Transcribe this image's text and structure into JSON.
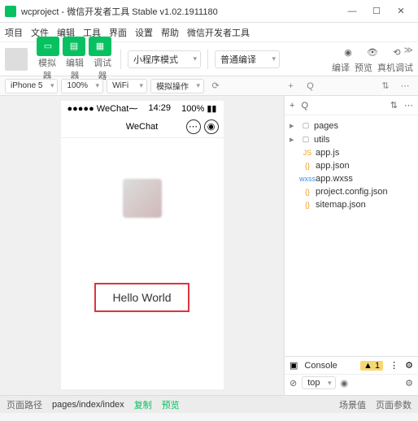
{
  "window": {
    "title": "wcproject - 微信开发者工具 Stable v1.02.1911180"
  },
  "menu": [
    "项目",
    "文件",
    "编辑",
    "工具",
    "界面",
    "设置",
    "帮助",
    "微信开发者工具"
  ],
  "toolbar": {
    "labels": [
      "模拟器",
      "编辑器",
      "调试器"
    ],
    "mode": "小程序模式",
    "compile": "普通编译",
    "right_labels": [
      "编译",
      "预览",
      "真机调试"
    ]
  },
  "subbar": {
    "device": "iPhone 5",
    "zoom": "100%",
    "network": "WiFi",
    "action": "模拟操作"
  },
  "phone": {
    "carrier": "●●●●● WeChat",
    "signal": "⁓",
    "time": "14:29",
    "battery": "100%",
    "title": "WeChat",
    "hello": "Hello World"
  },
  "tree": {
    "folders": [
      "pages",
      "utils"
    ],
    "files": [
      {
        "name": "app.js",
        "cls": "ti-js",
        "label": "JS"
      },
      {
        "name": "app.json",
        "cls": "ti-json",
        "label": "{}"
      },
      {
        "name": "app.wxss",
        "cls": "ti-wxss",
        "label": "wxss"
      },
      {
        "name": "project.config.json",
        "cls": "ti-json",
        "label": "{}"
      },
      {
        "name": "sitemap.json",
        "cls": "ti-json",
        "label": "{}"
      }
    ]
  },
  "console": {
    "tab": "Console",
    "warn": "1",
    "filter": "top"
  },
  "footer": {
    "label": "页面路径",
    "path": "pages/index/index",
    "copy": "复制",
    "preview": "预览",
    "scene": "场景值",
    "params": "页面参数"
  }
}
